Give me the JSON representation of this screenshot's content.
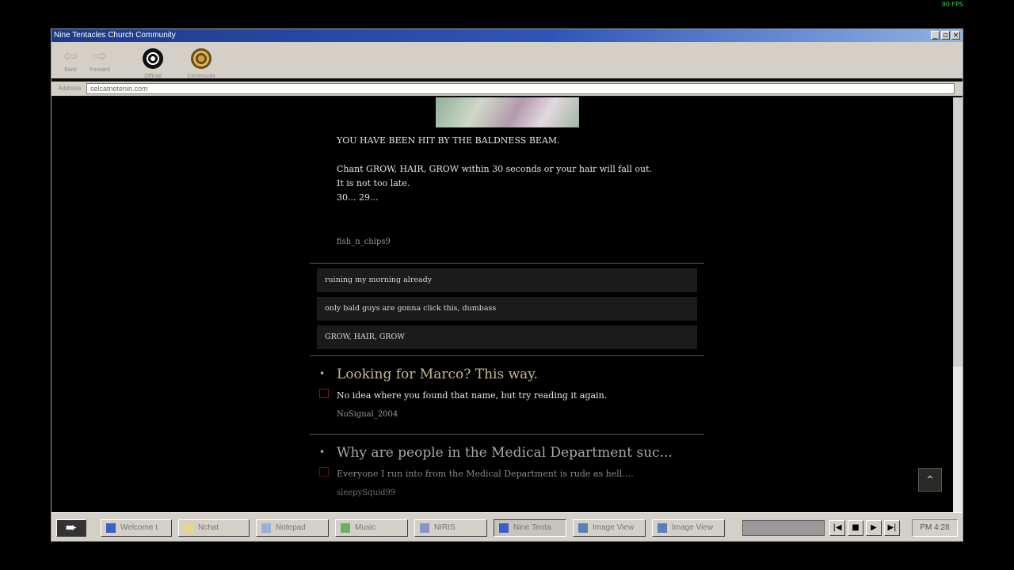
{
  "fps": "90 FPS",
  "window": {
    "title": "Nine Tentacles Church Community"
  },
  "toolbar": {
    "back_label": "Back",
    "forward_label": "Forward",
    "official_label": "Official",
    "community_label": "Community"
  },
  "address": {
    "label": "Address",
    "value": "selcatnetenin.com"
  },
  "post": {
    "line1": "YOU HAVE BEEN HIT BY THE BALDNESS BEAM.",
    "line2": "Chant GROW, HAIR, GROW within 30 seconds or your hair will fall out.",
    "line3": "It is not too late.",
    "line4": "30... 29...",
    "author": "fish_n_chips9"
  },
  "comments": [
    "ruining my morning already",
    "only bald guys are gonna click this, dumbass",
    "GROW, HAIR, GROW"
  ],
  "threads": [
    {
      "title": "Looking for Marco? This way.",
      "snippet": "No idea where you found that name, but try reading it again.",
      "author": "NoSignal_2004"
    },
    {
      "title": "Why are people in the Medical Department suc...",
      "snippet": "Everyone I run into from the Medical Department is rude as hell.…",
      "author": "sleepySquid99"
    }
  ],
  "taskbar": {
    "items": [
      "Welcome t",
      "Nchat",
      "Notepad",
      "Music",
      "NIRIS",
      "Nine Tenta",
      "Image View",
      "Image View"
    ],
    "clock": "PM 4:28"
  },
  "colors": {
    "title_accent": "#c9b98e",
    "bg": "#000000",
    "titlebar": "#1d3a8a"
  }
}
